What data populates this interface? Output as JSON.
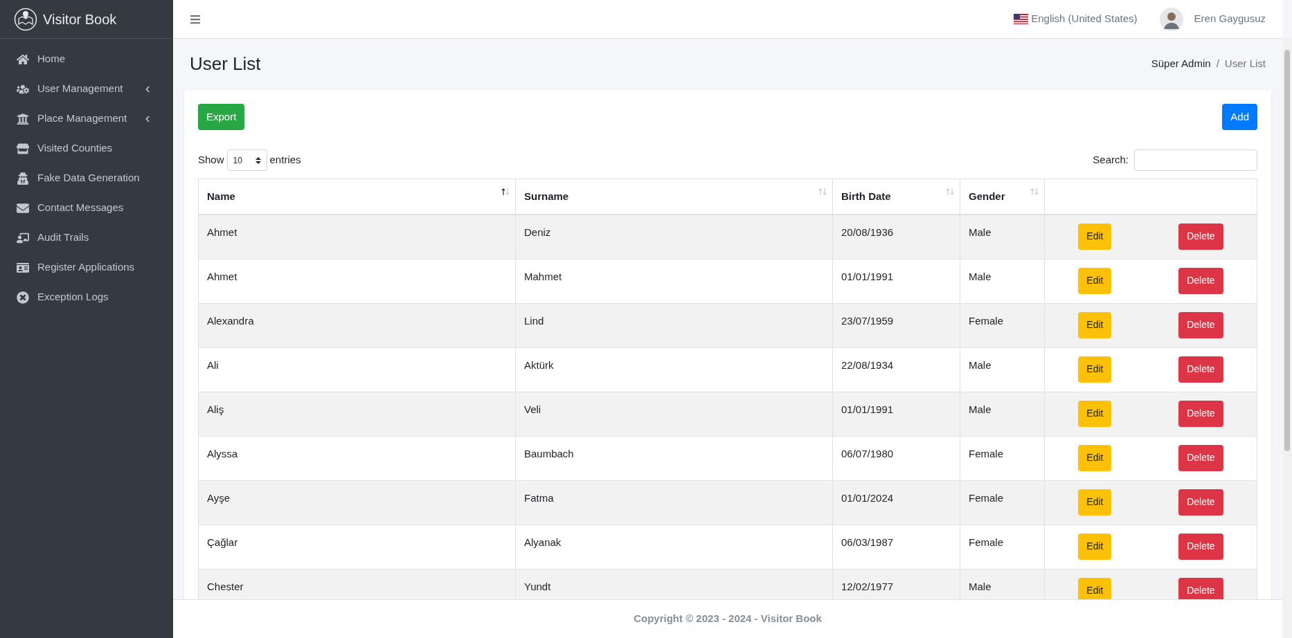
{
  "brand": "Visitor Book",
  "sidebar": {
    "items": [
      {
        "label": "Home",
        "has_submenu": false
      },
      {
        "label": "User Management",
        "has_submenu": true
      },
      {
        "label": "Place Management",
        "has_submenu": true
      },
      {
        "label": "Visited Counties",
        "has_submenu": false
      },
      {
        "label": "Fake Data Generation",
        "has_submenu": false
      },
      {
        "label": "Contact Messages",
        "has_submenu": false
      },
      {
        "label": "Audit Trails",
        "has_submenu": false
      },
      {
        "label": "Register Applications",
        "has_submenu": false
      },
      {
        "label": "Exception Logs",
        "has_submenu": false
      }
    ]
  },
  "topbar": {
    "language": "English (United States)",
    "user": "Eren Gaygusuz"
  },
  "page": {
    "title": "User List",
    "breadcrumb": [
      {
        "label": "Süper Admin"
      },
      {
        "separator": "/",
        "label": "User List"
      }
    ]
  },
  "toolbar": {
    "export": "Export",
    "add": "Add"
  },
  "length": {
    "before": "Show",
    "value": "10",
    "after": "entries"
  },
  "search": {
    "label": "Search:"
  },
  "table": {
    "columns": [
      {
        "label": "Name",
        "sorted": true
      },
      {
        "label": "Surname",
        "sorted": false
      },
      {
        "label": "Birth Date",
        "sorted": false
      },
      {
        "label": "Gender",
        "sorted": false
      }
    ],
    "rows": [
      {
        "cells": [
          "Ahmet",
          "Deniz",
          "20/08/1936",
          "Male"
        ],
        "edit": "Edit",
        "delete": "Delete"
      },
      {
        "cells": [
          "Ahmet",
          "Mahmet",
          "01/01/1991",
          "Male"
        ],
        "edit": "Edit",
        "delete": "Delete"
      },
      {
        "cells": [
          "Alexandra",
          "Lind",
          "23/07/1959",
          "Female"
        ],
        "edit": "Edit",
        "delete": "Delete"
      },
      {
        "cells": [
          "Ali",
          "Aktürk",
          "22/08/1934",
          "Male"
        ],
        "edit": "Edit",
        "delete": "Delete"
      },
      {
        "cells": [
          "Aliş",
          "Veli",
          "01/01/1991",
          "Male"
        ],
        "edit": "Edit",
        "delete": "Delete"
      },
      {
        "cells": [
          "Alyssa",
          "Baumbach",
          "06/07/1980",
          "Female"
        ],
        "edit": "Edit",
        "delete": "Delete"
      },
      {
        "cells": [
          "Ayşe",
          "Fatma",
          "01/01/2024",
          "Female"
        ],
        "edit": "Edit",
        "delete": "Delete"
      },
      {
        "cells": [
          "Çağlar",
          "Alyanak",
          "06/03/1987",
          "Female"
        ],
        "edit": "Edit",
        "delete": "Delete"
      },
      {
        "cells": [
          "Chester",
          "Yundt",
          "12/02/1977",
          "Male"
        ],
        "edit": "Edit",
        "delete": "Delete"
      }
    ]
  },
  "footer": "Copyright © 2023 - 2024 - Visitor Book"
}
